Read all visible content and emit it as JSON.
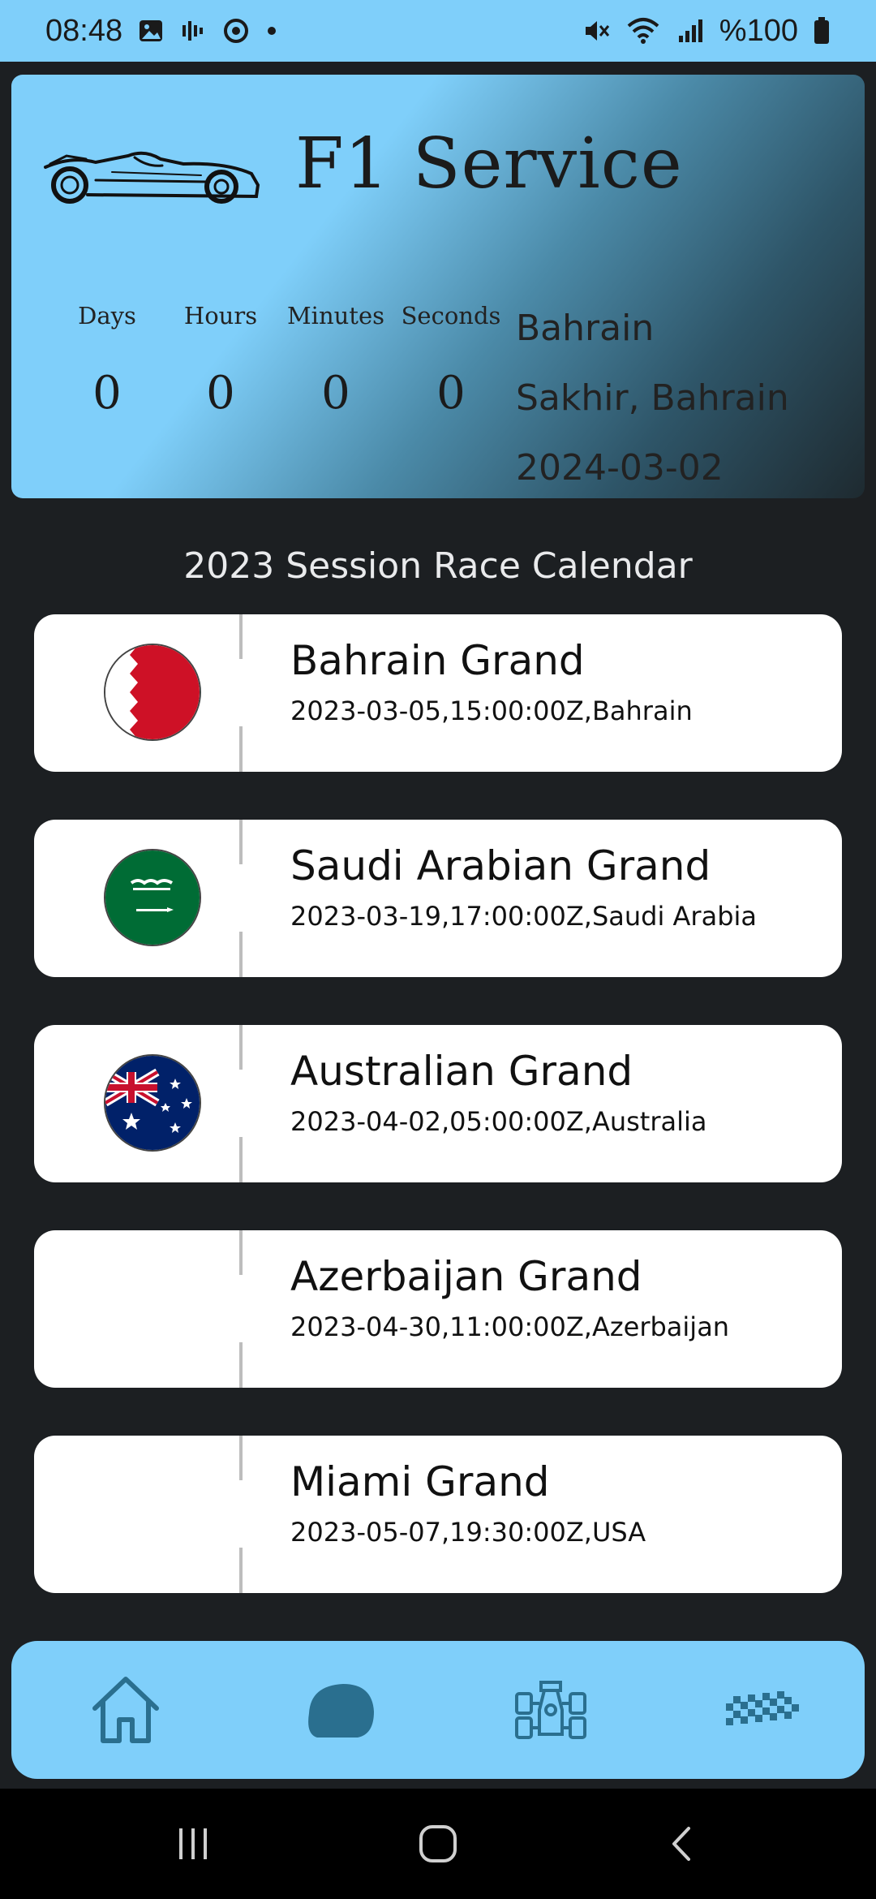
{
  "status_bar": {
    "time": "08:48",
    "battery_text": "%100",
    "icons_left": [
      "image-icon",
      "voice-icon",
      "sync-icon",
      "dot-icon"
    ],
    "icons_right": [
      "mute-icon",
      "wifi-icon",
      "signal-icon",
      "battery-icon"
    ]
  },
  "header": {
    "title": "F1 Service",
    "logo_icon": "f1-car-icon",
    "countdown": [
      {
        "label": "Days",
        "value": "0"
      },
      {
        "label": "Hours",
        "value": "0"
      },
      {
        "label": "Minutes",
        "value": "0"
      },
      {
        "label": "Seconds",
        "value": "0"
      }
    ],
    "next_race": {
      "name": "Bahrain",
      "location": "Sakhir, Bahrain",
      "date": "2024-03-02"
    }
  },
  "calendar": {
    "title": "2023 Session Race Calendar",
    "races": [
      {
        "name": "Bahrain Grand",
        "info": "2023-03-05,15:00:00Z,Bahrain",
        "flag": "bahrain-flag-icon"
      },
      {
        "name": "Saudi Arabian Grand",
        "info": "2023-03-19,17:00:00Z,Saudi Arabia",
        "flag": "saudi-arabia-flag-icon"
      },
      {
        "name": "Australian Grand",
        "info": "2023-04-02,05:00:00Z,Australia",
        "flag": "australia-flag-icon"
      },
      {
        "name": "Azerbaijan Grand",
        "info": "2023-04-30,11:00:00Z,Azerbaijan",
        "flag": ""
      },
      {
        "name": "Miami Grand",
        "info": "2023-05-07,19:30:00Z,USA",
        "flag": ""
      }
    ]
  },
  "bottom_nav": {
    "items": [
      "home-icon",
      "helmet-icon",
      "race-car-icon",
      "checkered-flag-icon"
    ]
  },
  "system_nav": [
    "recents-icon",
    "home-circle-icon",
    "back-icon"
  ],
  "colors": {
    "accent": "#7fcffa",
    "background": "#1c1f22",
    "nav_icon": "#2a6f8f"
  }
}
